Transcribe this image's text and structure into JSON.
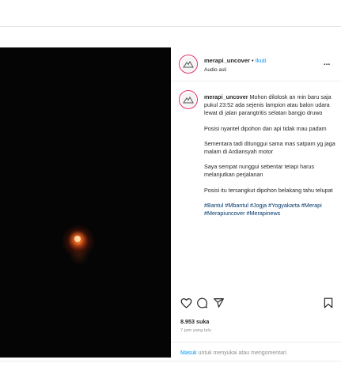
{
  "post": {
    "username": "merapi_uncover",
    "separator": "•",
    "follow_label": "Ikuti",
    "audio_label": "Audio asli",
    "more_label": "...",
    "caption_paragraphs": [
      "Mohon dilolosk an min baru saja pukul 23:52 ada sejenis lampion atau balon udara lewat di jalan parangtritis selatan bangjo druwo",
      "Posisi nyantel dipohon dan api tidak mau padam",
      "Sementara tadi ditunggui sama mas satpam yg jaga malam di Ardiansyah motor",
      "Saya sempat nunggui sebentar tetapi harus melanjutkan perjalanan",
      "Posisi itu tersangkut dipohon belakang tahu telupat"
    ],
    "hashtags": "#Bantul #Mbantul #Jogja #Yogyakarta #Merapi #Merapiuncover #Merapinews",
    "likes": "8.953 suka",
    "time_ago": "7 jam yang lalu",
    "login_link": "Masuk",
    "login_text": " untuk menyukai atau mengomentari."
  },
  "icons": {
    "like": "heart-icon",
    "comment": "comment-icon",
    "share": "send-icon",
    "save": "bookmark-icon",
    "audio": "speaker-icon"
  },
  "colors": {
    "accent": "#0095f6",
    "hashtag": "#00376b",
    "avatar_ring": "#e1306c"
  }
}
